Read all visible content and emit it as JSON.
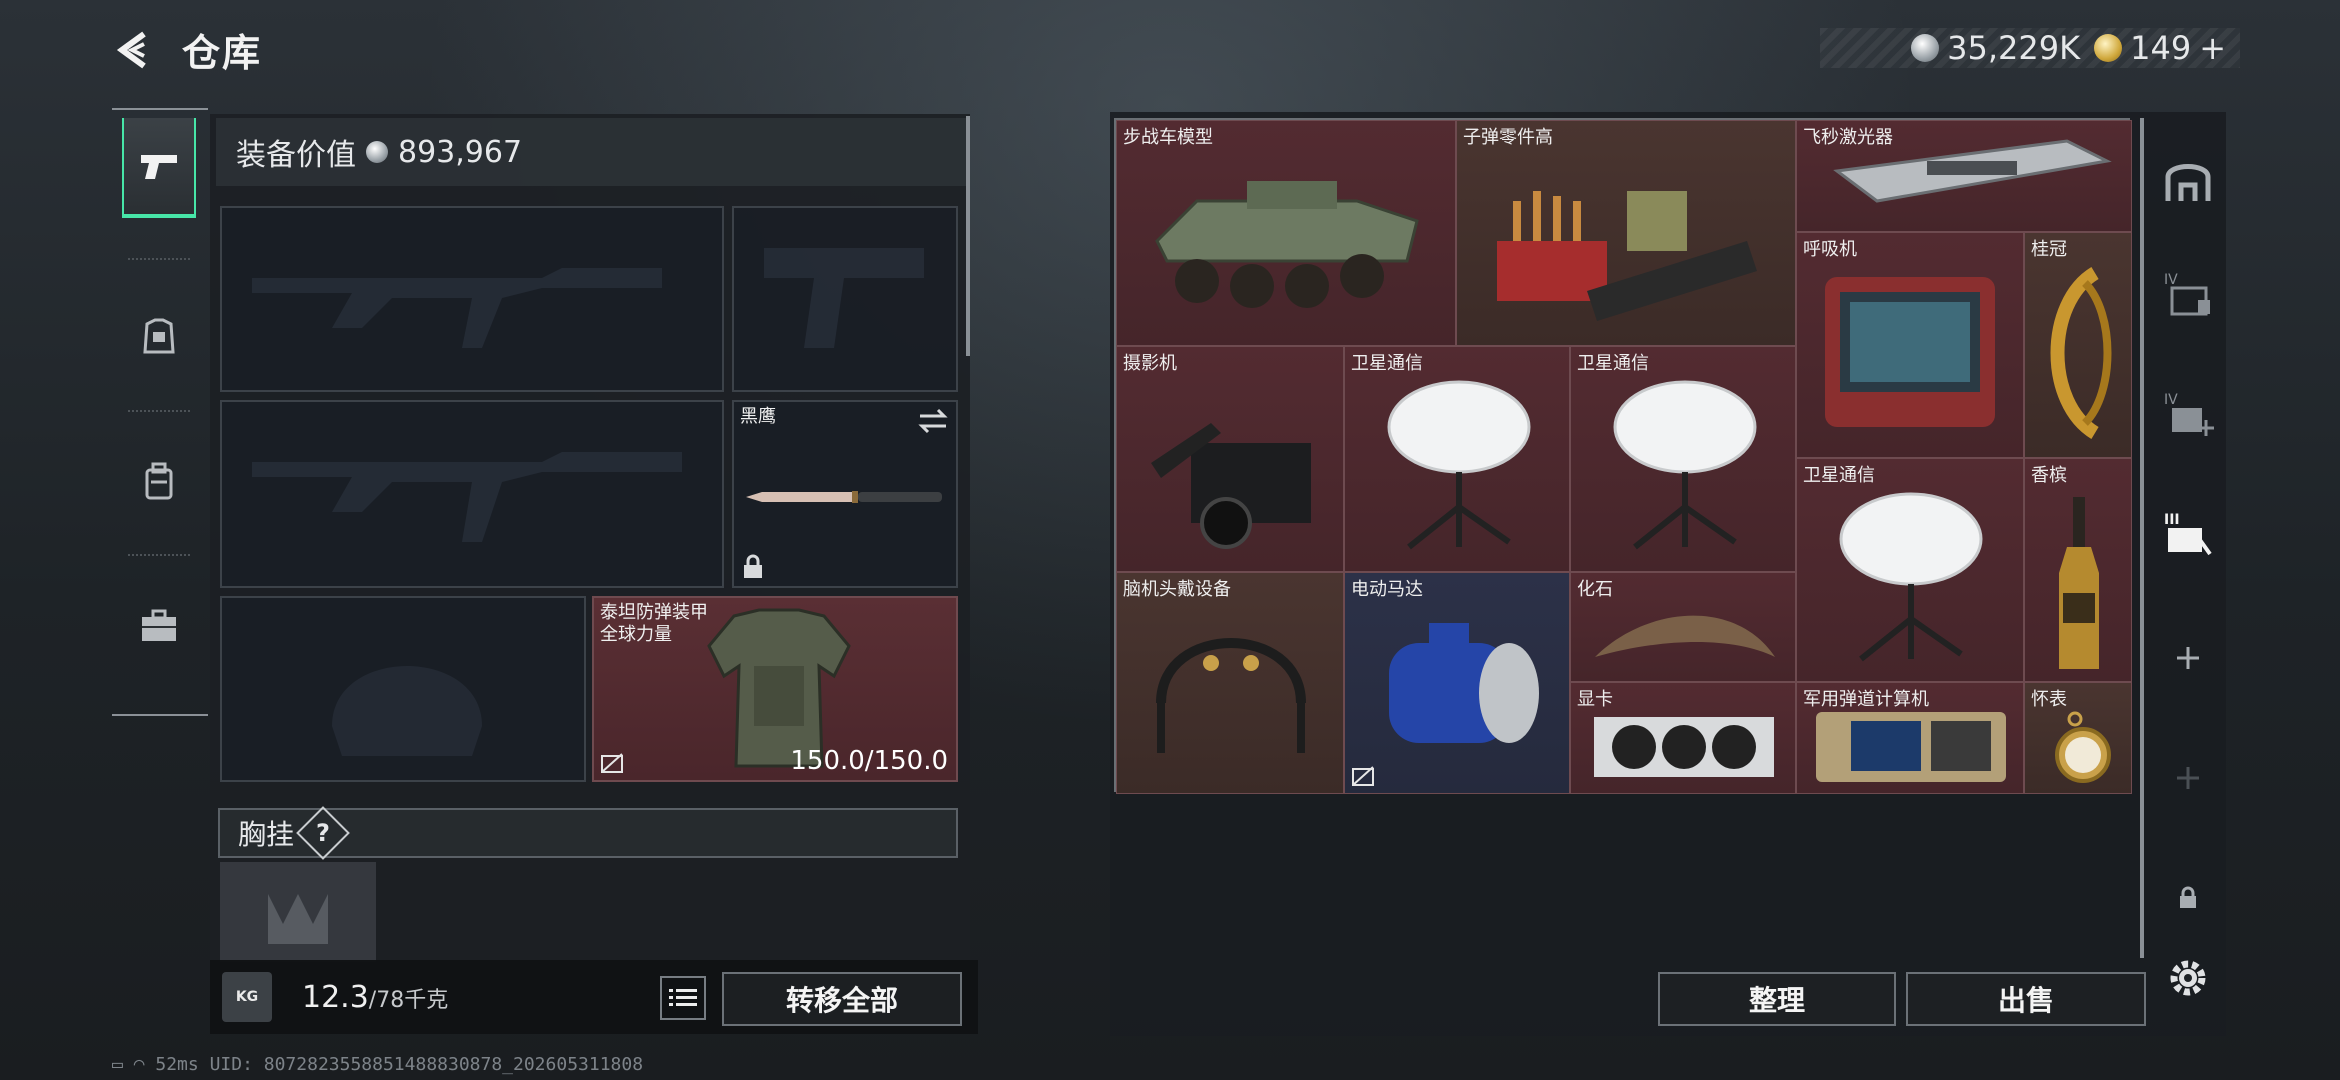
{
  "header": {
    "title": "仓库",
    "silver_amount": "35,229K",
    "gold_amount": "149",
    "gold_plus": "+"
  },
  "left_tabs": [
    {
      "name": "weapons",
      "icon": "pistol-icon",
      "active": true
    },
    {
      "name": "armor",
      "icon": "armor-icon",
      "active": false
    },
    {
      "name": "backpack",
      "icon": "backpack-icon",
      "active": false
    },
    {
      "name": "toolbox",
      "icon": "toolbox-icon",
      "active": false
    }
  ],
  "equipment": {
    "value_label": "装备价值",
    "value": "893,967",
    "melee_label": "黑鹰",
    "armor_label_1": "泰坦防弹装甲",
    "armor_label_2": "全球力量",
    "armor_durability": "150.0/150.0",
    "chest_rig_label": "胸挂",
    "help": "?"
  },
  "weight": {
    "current": "12.3",
    "max": "/78千克",
    "unit_icon": "KG"
  },
  "buttons": {
    "transfer_all": "转移全部",
    "organize": "整理",
    "sell": "出售"
  },
  "storage_items": [
    {
      "label": "步战车模型"
    },
    {
      "label": "子弹零件高"
    },
    {
      "label": "飞秒激光器"
    },
    {
      "label": "呼吸机"
    },
    {
      "label": "桂冠"
    },
    {
      "label": "摄影机"
    },
    {
      "label": "卫星通信"
    },
    {
      "label": "卫星通信"
    },
    {
      "label": "卫星通信"
    },
    {
      "label": "香槟"
    },
    {
      "label": "脑机头戴设备"
    },
    {
      "label": "电动马达"
    },
    {
      "label": "化石"
    },
    {
      "label": "显卡"
    },
    {
      "label": "军用弹道计算机"
    },
    {
      "label": "怀表"
    }
  ],
  "status": {
    "ping": "52ms",
    "code": "UID: 8072823558851488830878_202605311808"
  },
  "colors": {
    "accent_green": "#47e6a8",
    "item_red": "#532b31",
    "item_blue": "#2c3148"
  }
}
